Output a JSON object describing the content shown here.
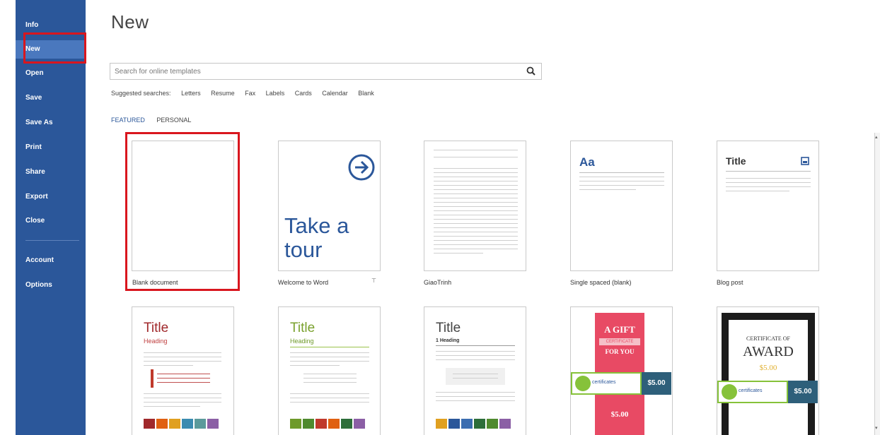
{
  "sidebar": {
    "items": [
      {
        "label": "Info"
      },
      {
        "label": "New"
      },
      {
        "label": "Open"
      },
      {
        "label": "Save"
      },
      {
        "label": "Save As"
      },
      {
        "label": "Print"
      },
      {
        "label": "Share"
      },
      {
        "label": "Export"
      },
      {
        "label": "Close"
      },
      {
        "label": "Account"
      },
      {
        "label": "Options"
      }
    ],
    "active": "New"
  },
  "page": {
    "title": "New"
  },
  "search": {
    "placeholder": "Search for online templates",
    "icon": "search-icon"
  },
  "suggested": {
    "label": "Suggested searches:",
    "items": [
      "Letters",
      "Resume",
      "Fax",
      "Labels",
      "Cards",
      "Calendar",
      "Blank"
    ]
  },
  "tabs": [
    {
      "label": "FEATURED"
    },
    {
      "label": "PERSONAL"
    }
  ],
  "templates": {
    "blank": {
      "label": "Blank document"
    },
    "tour": {
      "label": "Welcome to Word",
      "line1": "Take a",
      "line2": "tour",
      "pin": "⊤"
    },
    "giaotrinh": {
      "label": "GiaoTrinh"
    },
    "single": {
      "label": "Single spaced (blank)",
      "aa": "Aa"
    },
    "blog": {
      "label": "Blog post",
      "title": "Title"
    },
    "report1": {
      "title": "Title",
      "heading": "Heading"
    },
    "report2": {
      "title": "Title",
      "heading": "Heading"
    },
    "report3": {
      "title": "Title",
      "heading": "1 Heading"
    },
    "gift": {
      "line1": "A GIFT",
      "line2": "CERTIFICATE",
      "line3": "FOR YOU",
      "brand": "certificates",
      "price": "$5.00",
      "price2": "$5.00"
    },
    "award": {
      "line1": "CERTIFICATE OF",
      "line2": "AWARD",
      "amount": "$5.00",
      "brand": "certificates",
      "price": "$5.00"
    }
  },
  "colors": {
    "accent": "#2b579a",
    "highlight": "#d9161e"
  }
}
